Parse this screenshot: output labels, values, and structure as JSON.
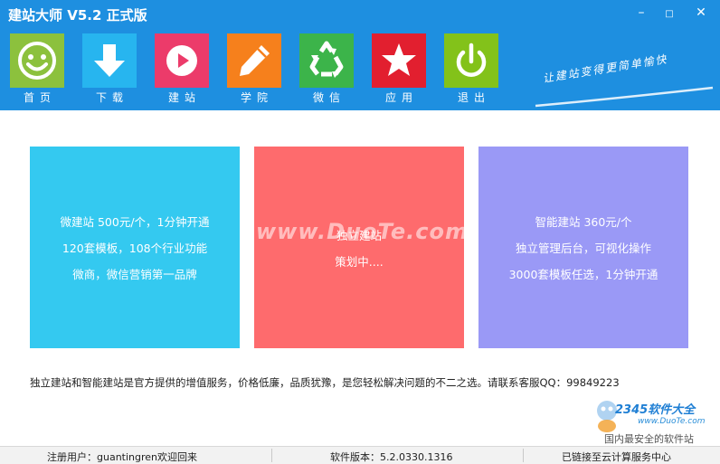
{
  "window": {
    "title": "建站大师 V5.2 正式版",
    "min_label": "–",
    "max_label": "□",
    "close_label": "✕"
  },
  "nav": {
    "items": [
      {
        "label": "首页",
        "color": "#8cc13d",
        "icon": "smiley-icon"
      },
      {
        "label": "下载",
        "color": "#27b5ef",
        "icon": "download-arrow-icon"
      },
      {
        "label": "建站",
        "color": "#ec3b6a",
        "icon": "play-icon"
      },
      {
        "label": "学院",
        "color": "#f6801c",
        "icon": "pencil-icon"
      },
      {
        "label": "微信",
        "color": "#3cb44a",
        "icon": "recycle-icon"
      },
      {
        "label": "应用",
        "color": "#e21f2f",
        "icon": "star-icon"
      },
      {
        "label": "退出",
        "color": "#83c21a",
        "icon": "power-icon"
      }
    ]
  },
  "slogan": "让建站变得更简单愉快",
  "cards": [
    {
      "color": "#34c9f0",
      "lines": [
        "微建站 500元/个，1分钟开通",
        "120套模板，108个行业功能",
        "微商，微信营销第一品牌"
      ]
    },
    {
      "color": "#fe6b6d",
      "lines": [
        "独立建站",
        "策划中...."
      ]
    },
    {
      "color": "#9a99f6",
      "lines": [
        "智能建站  360元/个",
        "独立管理后台，可视化操作",
        "3000套模板任选，1分钟开通"
      ]
    }
  ],
  "watermark": "www.DuoTe.com",
  "notice": "独立建站和智能建站是官方提供的增值服务，价格低廉，品质犹豫，是您轻松解决问题的不二之选。请联系客服QQ：99849223",
  "logo2345": {
    "brand": "2345软件大全",
    "url": "www.DuoTe.com",
    "tagline": "国内最安全的软件站"
  },
  "status": {
    "user": "注册用户：guantingren欢迎回来",
    "version": "软件版本：5.2.0330.1316",
    "cloud": "已链接至云计算服务中心"
  }
}
